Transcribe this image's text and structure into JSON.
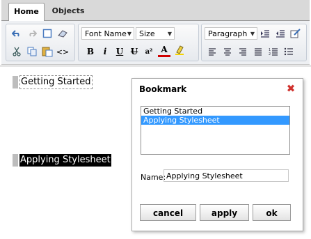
{
  "tabs": [
    {
      "label": "Home",
      "active": true
    },
    {
      "label": "Objects",
      "active": false
    }
  ],
  "toolbar": {
    "font_name": "Font Name",
    "font_size": "Size",
    "block_format": "Paragraph",
    "icons": {
      "undo": "undo-icon",
      "redo": "redo-icon",
      "select_all": "select-all-icon",
      "eraser": "eraser-icon",
      "cut": "cut-icon",
      "copy": "copy-icon",
      "paste": "paste-icon",
      "source": "source-code-icon",
      "bold": "bold-icon",
      "italic": "italic-icon",
      "underline": "underline-icon",
      "strike": "strikethrough-icon",
      "superscript": "superscript-icon",
      "font_color": "font-color-icon",
      "highlight": "highlight-icon",
      "indent": "indent-icon",
      "outdent": "outdent-icon",
      "edit": "edit-icon",
      "align_left": "align-left-icon",
      "align_center": "align-center-icon",
      "align_right": "align-right-icon",
      "justify": "justify-icon",
      "numbered_list": "numbered-list-icon",
      "bullet_list": "bullet-list-icon"
    },
    "glyphs": {
      "code": "<>",
      "bold": "B",
      "italic": "i",
      "underline": "U",
      "strike": "U",
      "superscript": "a²",
      "font_color": "A"
    }
  },
  "editor": {
    "bookmark1": "Getting Started",
    "bookmark2": "Applying Stylesheet"
  },
  "dialog": {
    "title": "Bookmark",
    "list": [
      "Getting Started",
      "Applying Stylesheet"
    ],
    "selected_index": 1,
    "name_label": "Name:",
    "name_value": "Applying Stylesheet",
    "buttons": {
      "cancel": "cancel",
      "apply": "apply",
      "ok": "ok"
    }
  },
  "colors": {
    "selection": "#3399ff",
    "close": "#d0312d",
    "font_color_bar": "#d00000"
  }
}
